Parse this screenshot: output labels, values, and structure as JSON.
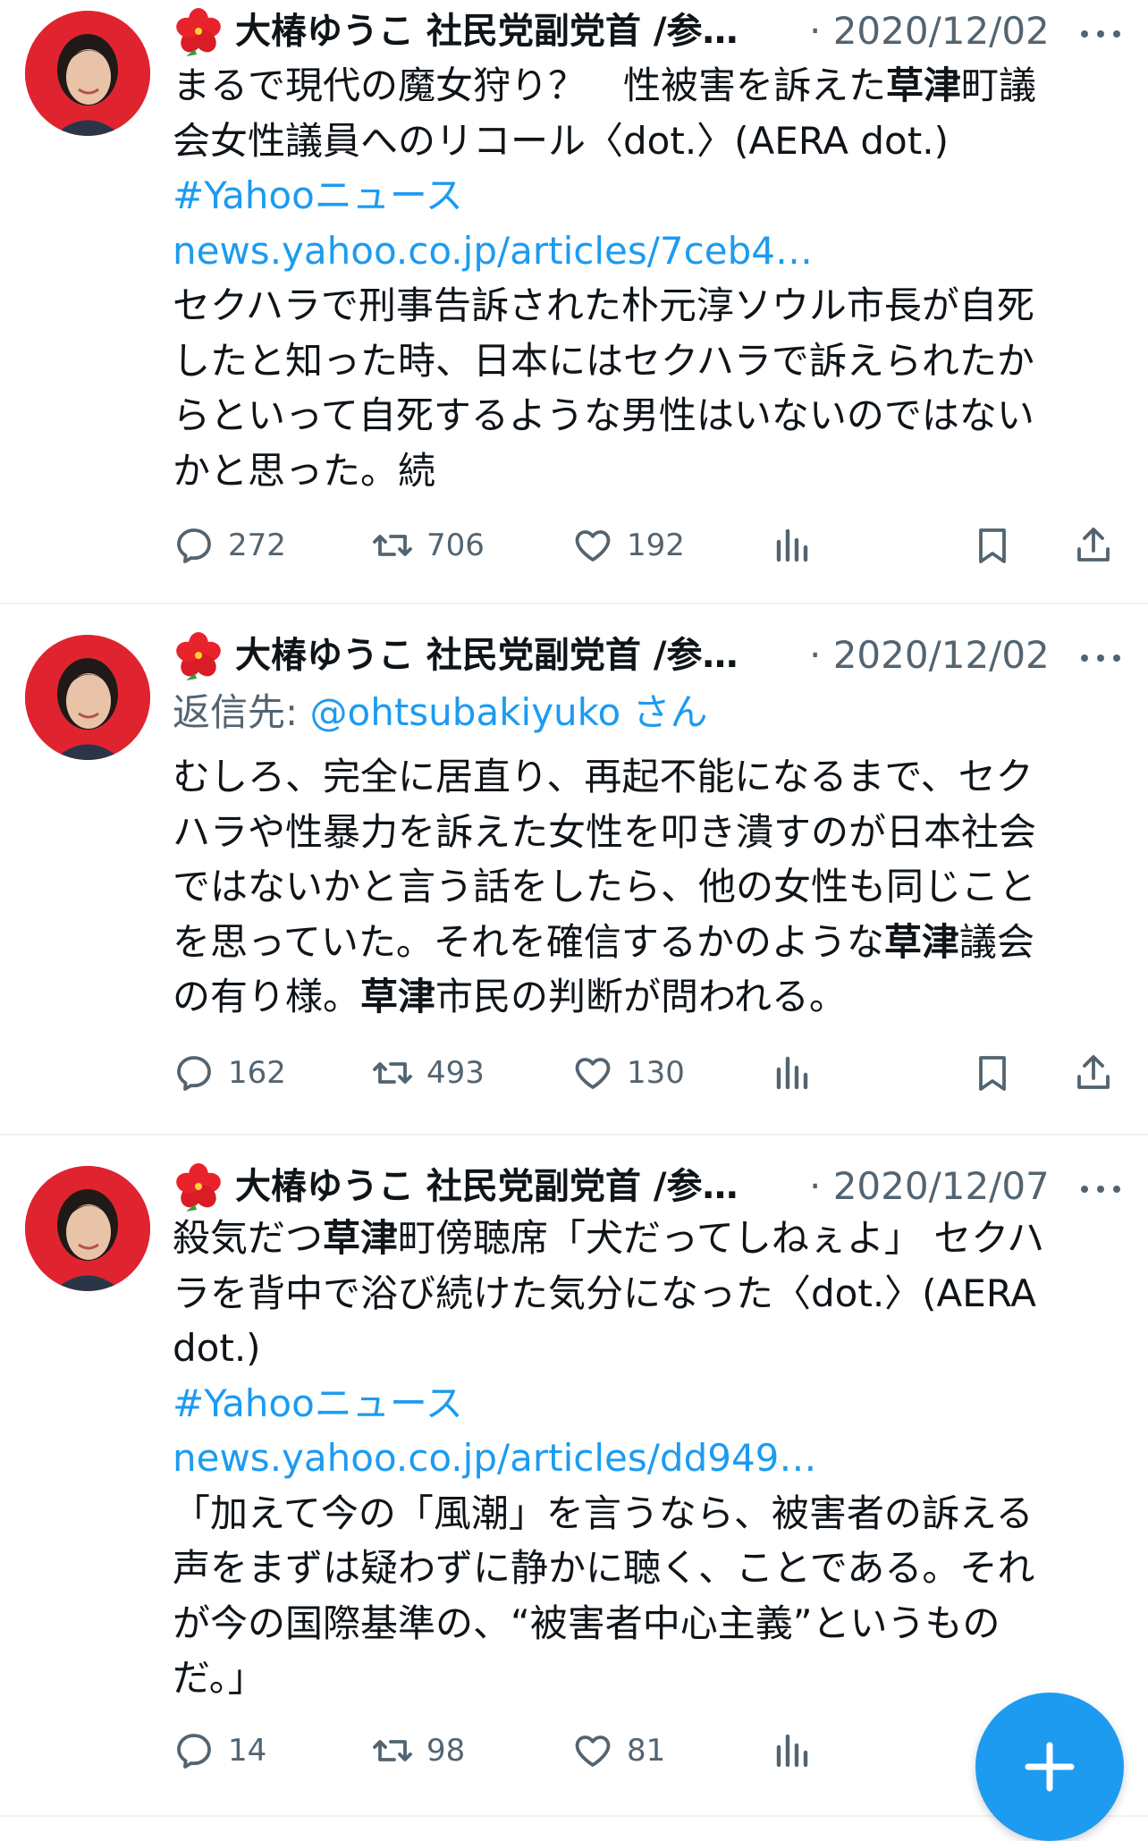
{
  "author": {
    "name": "大椿ゆうこ 社民党副党首 /参…",
    "flower_icon": "hibiscus-icon",
    "avatar_color": "#e0242f"
  },
  "colors": {
    "link": "#1d9bf0",
    "muted": "#536471",
    "text": "#0f1419"
  },
  "tweets": [
    {
      "date": "· 2020/12/02",
      "lines": [
        [
          {
            "t": "まるで現代の魔女狩り？　性被害を訴えた"
          },
          {
            "t": "草津",
            "b": true
          },
          {
            "t": "町議"
          }
        ],
        [
          {
            "t": "会女性議員へのリコール〈dot.〉(AERA dot.)"
          }
        ],
        [
          {
            "t": "#Yahooニュース",
            "link": true
          }
        ],
        [
          {
            "t": "news.yahoo.co.jp/articles/7ceb4…",
            "link": true
          }
        ],
        [
          {
            "t": "セクハラで刑事告訴された朴元淳ソウル市長が自死"
          }
        ],
        [
          {
            "t": "したと知った時、日本にはセクハラで訴えられたか"
          }
        ],
        [
          {
            "t": "らといって自死するような男性はいないのではない"
          }
        ],
        [
          {
            "t": "かと思った。続"
          }
        ]
      ],
      "replies": "272",
      "retweets": "706",
      "likes": "192"
    },
    {
      "date": "· 2020/12/02",
      "reply_to_label": "返信先: ",
      "reply_to_handle": "@ohtsubakiyuko さん",
      "lines": [
        [
          {
            "t": "むしろ、完全に居直り、再起不能になるまで、セク"
          }
        ],
        [
          {
            "t": "ハラや性暴力を訴えた女性を叩き潰すのが日本社会"
          }
        ],
        [
          {
            "t": "ではないかと言う話をしたら、他の女性も同じこと"
          }
        ],
        [
          {
            "t": "を思っていた。それを確信するかのような"
          },
          {
            "t": "草津",
            "b": true
          },
          {
            "t": "議会"
          }
        ],
        [
          {
            "t": "の有り様。"
          },
          {
            "t": "草津",
            "b": true
          },
          {
            "t": "市民の判断が問われる。"
          }
        ]
      ],
      "replies": "162",
      "retweets": "493",
      "likes": "130"
    },
    {
      "date": "· 2020/12/07",
      "lines": [
        [
          {
            "t": "殺気だつ"
          },
          {
            "t": "草津",
            "b": true
          },
          {
            "t": "町傍聴席「犬だってしねぇよ」 セクハ"
          }
        ],
        [
          {
            "t": "ラを背中で浴び続けた気分になった〈dot.〉(AERA"
          }
        ],
        [
          {
            "t": "dot.)"
          }
        ],
        [
          {
            "t": "#Yahooニュース",
            "link": true
          }
        ],
        [
          {
            "t": "news.yahoo.co.jp/articles/dd949…",
            "link": true
          }
        ],
        [
          {
            "t": "「加えて今の「風潮」を言うなら、被害者の訴える"
          }
        ],
        [
          {
            "t": "声をまずは疑わずに静かに聴く、ことである。それ"
          }
        ],
        [
          {
            "t": "が今の国際基準の、“被害者中心主義”というもの"
          }
        ],
        [
          {
            "t": "だ。」"
          }
        ]
      ],
      "replies": "14",
      "retweets": "98",
      "likes": "81"
    }
  ],
  "icons": {
    "reply": "reply-icon",
    "retweet": "retweet-icon",
    "like": "heart-icon",
    "views": "views-icon",
    "bookmark": "bookmark-icon",
    "share": "share-icon",
    "compose": "plus-icon"
  }
}
